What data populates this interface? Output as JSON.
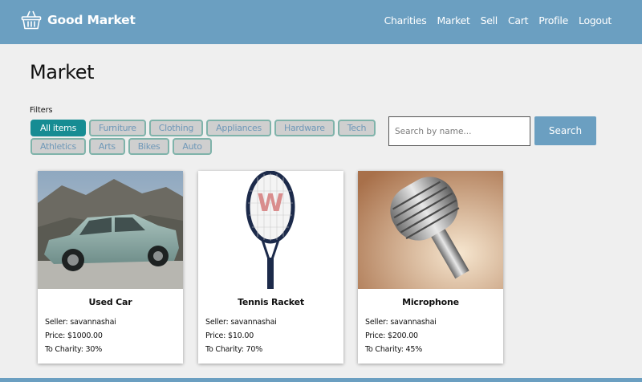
{
  "header": {
    "brand": "Good Market",
    "nav": [
      "Charities",
      "Market",
      "Sell",
      "Cart",
      "Profile",
      "Logout"
    ]
  },
  "page": {
    "title": "Market"
  },
  "filters": {
    "label": "Filters",
    "row1": [
      "All items",
      "Furniture",
      "Clothing",
      "Appliances",
      "Hardware",
      "Tech"
    ],
    "row2": [
      "Athletics",
      "Arts",
      "Bikes",
      "Auto"
    ],
    "active": "All items"
  },
  "search": {
    "placeholder": "Search by name...",
    "button": "Search"
  },
  "items": [
    {
      "name": "Used Car",
      "seller": "Seller: savannashai",
      "price": "Price: $1000.00",
      "charity": "To Charity: 30%"
    },
    {
      "name": "Tennis Racket",
      "seller": "Seller: savannashai",
      "price": "Price: $10.00",
      "charity": "To Charity: 70%"
    },
    {
      "name": "Microphone",
      "seller": "Seller: savannashai",
      "price": "Price: $200.00",
      "charity": "To Charity: 45%"
    }
  ],
  "colors": {
    "header": "#6b9fc1",
    "active_chip": "#168c93",
    "chip_bg": "#cfcfcf",
    "chip_text": "#6f98b8"
  }
}
